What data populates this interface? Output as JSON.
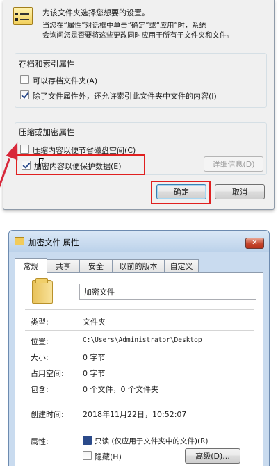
{
  "advanced_dialog": {
    "intro_line1": "为该文件夹选择您想要的设置。",
    "intro_line2": "当您在“属性”对话框中单击“确定”或“应用”时，系统",
    "intro_line3": "会询问您是否要将这些更改同时应用于所有子文件夹和文件。",
    "archive_group": {
      "title": "存档和索引属性",
      "options": [
        {
          "label": "可以存档文件夹(A)",
          "checked": false
        },
        {
          "label": "除了文件属性外，还允许索引此文件夹中文件的内容(I)",
          "checked": true
        }
      ]
    },
    "compress_group": {
      "title": "压缩或加密属性",
      "options": [
        {
          "label": "压缩内容以便节省磁盘空间(C)",
          "checked": false
        },
        {
          "label": "加密内容以便保护数据(E)",
          "checked": true
        }
      ],
      "details_button": "详细信息(D)"
    },
    "ok_button": "确定",
    "cancel_button": "取消",
    "highlight_color": "#e02020"
  },
  "properties_dialog": {
    "title": "加密文件 属性",
    "tabs": [
      "常规",
      "共享",
      "安全",
      "以前的版本",
      "自定义"
    ],
    "active_tab": "常规",
    "folder_name": "加密文件",
    "rows": [
      {
        "label": "类型:",
        "value": "文件夹"
      },
      {
        "label": "位置:",
        "value": "C:\\Users\\Administrator\\Desktop"
      },
      {
        "label": "大小:",
        "value": "0 字节"
      },
      {
        "label": "占用空间:",
        "value": "0 字节"
      },
      {
        "label": "包含:",
        "value": "0 个文件，0 个文件夹"
      },
      {
        "label": "创建时间:",
        "value": "2018年11月22日，10:52:07"
      }
    ],
    "attributes": {
      "label": "属性:",
      "readonly_label": "只读 (仅应用于文件夹中的文件)(R)",
      "hidden_label": "隐藏(H)",
      "advanced_button": "高级(D)..."
    }
  }
}
